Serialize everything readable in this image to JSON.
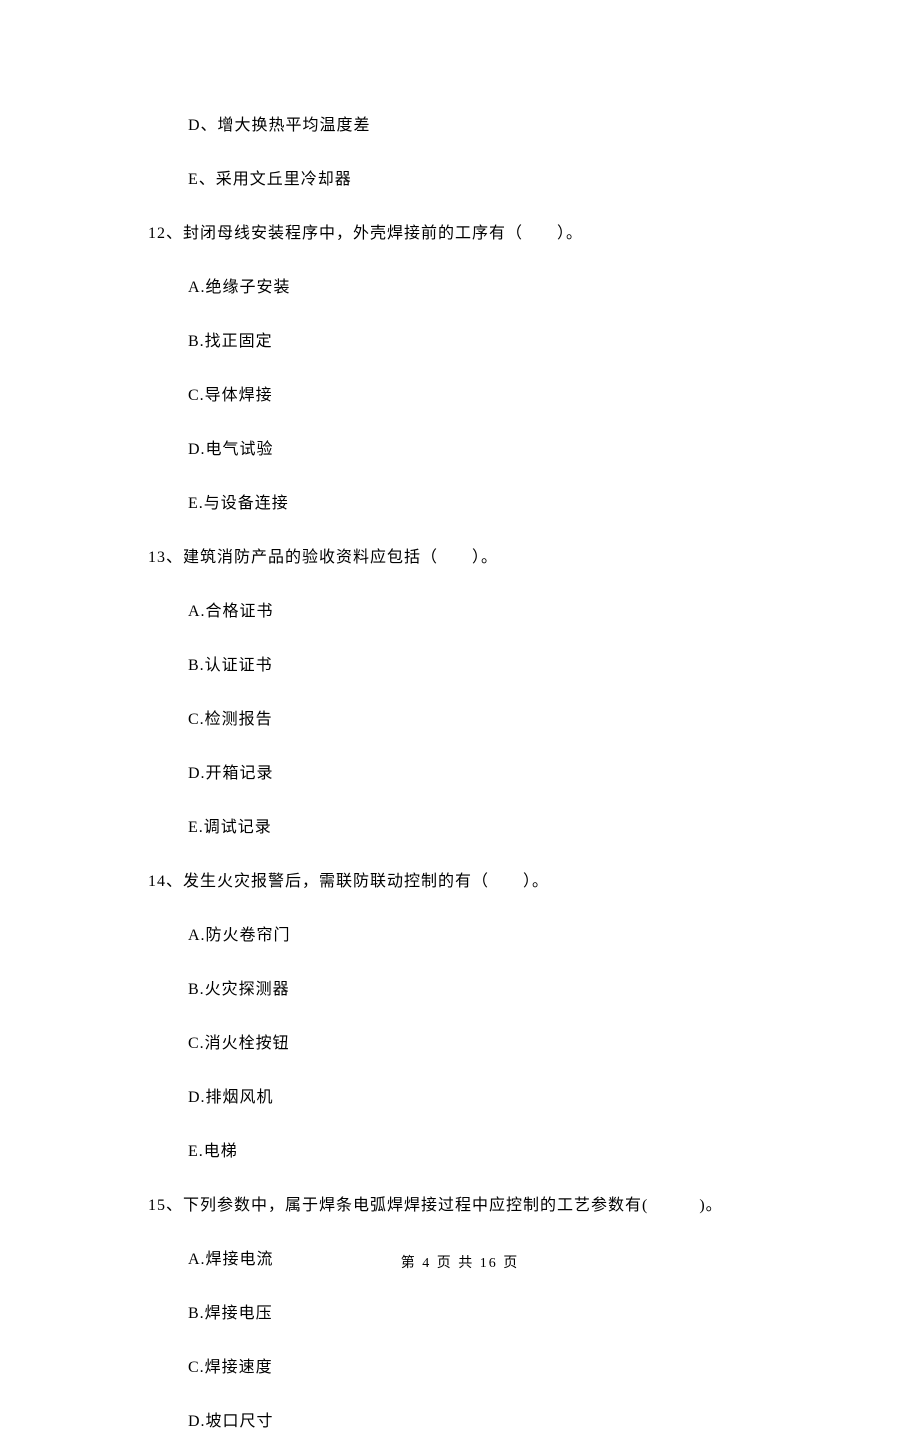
{
  "options_top": [
    "D、增大换热平均温度差",
    "E、采用文丘里冷却器"
  ],
  "questions": [
    {
      "stem": "12、封闭母线安装程序中，外壳焊接前的工序有（　　）。",
      "options": [
        "A.绝缘子安装",
        "B.找正固定",
        "C.导体焊接",
        "D.电气试验",
        "E.与设备连接"
      ]
    },
    {
      "stem": "13、建筑消防产品的验收资料应包括（　　）。",
      "options": [
        "A.合格证书",
        "B.认证证书",
        "C.检测报告",
        "D.开箱记录",
        "E.调试记录"
      ]
    },
    {
      "stem": "14、发生火灾报警后，需联防联动控制的有（　　）。",
      "options": [
        "A.防火卷帘门",
        "B.火灾探测器",
        "C.消火栓按钮",
        "D.排烟风机",
        "E.电梯"
      ]
    },
    {
      "stem": "15、下列参数中，属于焊条电弧焊焊接过程中应控制的工艺参数有(　　　)。",
      "options": [
        "A.焊接电流",
        "B.焊接电压",
        "C.焊接速度",
        "D.坡口尺寸"
      ]
    }
  ],
  "footer": "第 4 页 共 16 页"
}
